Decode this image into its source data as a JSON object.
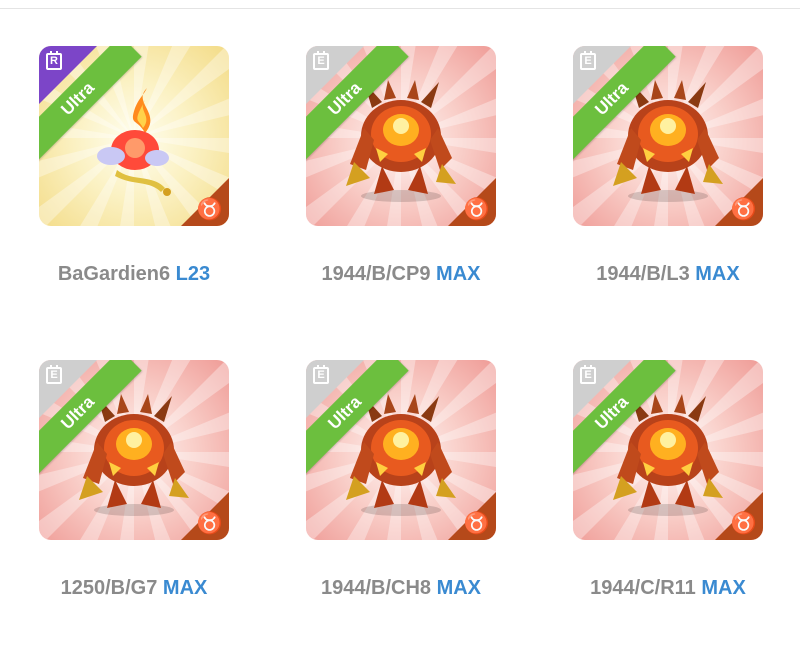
{
  "cards": [
    {
      "name": "BaGardien6",
      "level": "L23",
      "ribbon": "Ultra",
      "rarity_letter": "R",
      "rarity": "rare",
      "zodiac_icon": "taurus-icon",
      "zodiac_glyph": "♉",
      "creature": "fire-genie"
    },
    {
      "name": "1944/B/CP9",
      "level": "MAX",
      "ribbon": "Ultra",
      "rarity_letter": "E",
      "rarity": "epic",
      "zodiac_icon": "taurus-icon",
      "zodiac_glyph": "♉",
      "creature": "lava-golem"
    },
    {
      "name": "1944/B/L3",
      "level": "MAX",
      "ribbon": "Ultra",
      "rarity_letter": "E",
      "rarity": "epic",
      "zodiac_icon": "taurus-icon",
      "zodiac_glyph": "♉",
      "creature": "lava-golem"
    },
    {
      "name": "1250/B/G7",
      "level": "MAX",
      "ribbon": "Ultra",
      "rarity_letter": "E",
      "rarity": "epic",
      "zodiac_icon": "taurus-icon",
      "zodiac_glyph": "♉",
      "creature": "lava-golem"
    },
    {
      "name": "1944/B/CH8",
      "level": "MAX",
      "ribbon": "Ultra",
      "rarity_letter": "E",
      "rarity": "epic",
      "zodiac_icon": "taurus-icon",
      "zodiac_glyph": "♉",
      "creature": "lava-golem"
    },
    {
      "name": "1944/C/R11",
      "level": "MAX",
      "ribbon": "Ultra",
      "rarity_letter": "E",
      "rarity": "epic",
      "zodiac_icon": "taurus-icon",
      "zodiac_glyph": "♉",
      "creature": "lava-golem"
    }
  ],
  "colors": {
    "ribbon": "#6cbf3e",
    "level": "#3a8ad1",
    "name": "#8a8a8a",
    "rare_corner": "#7c45c8",
    "epic_corner": "#cfcfcf",
    "zodiac_corner": "#b5491a"
  }
}
